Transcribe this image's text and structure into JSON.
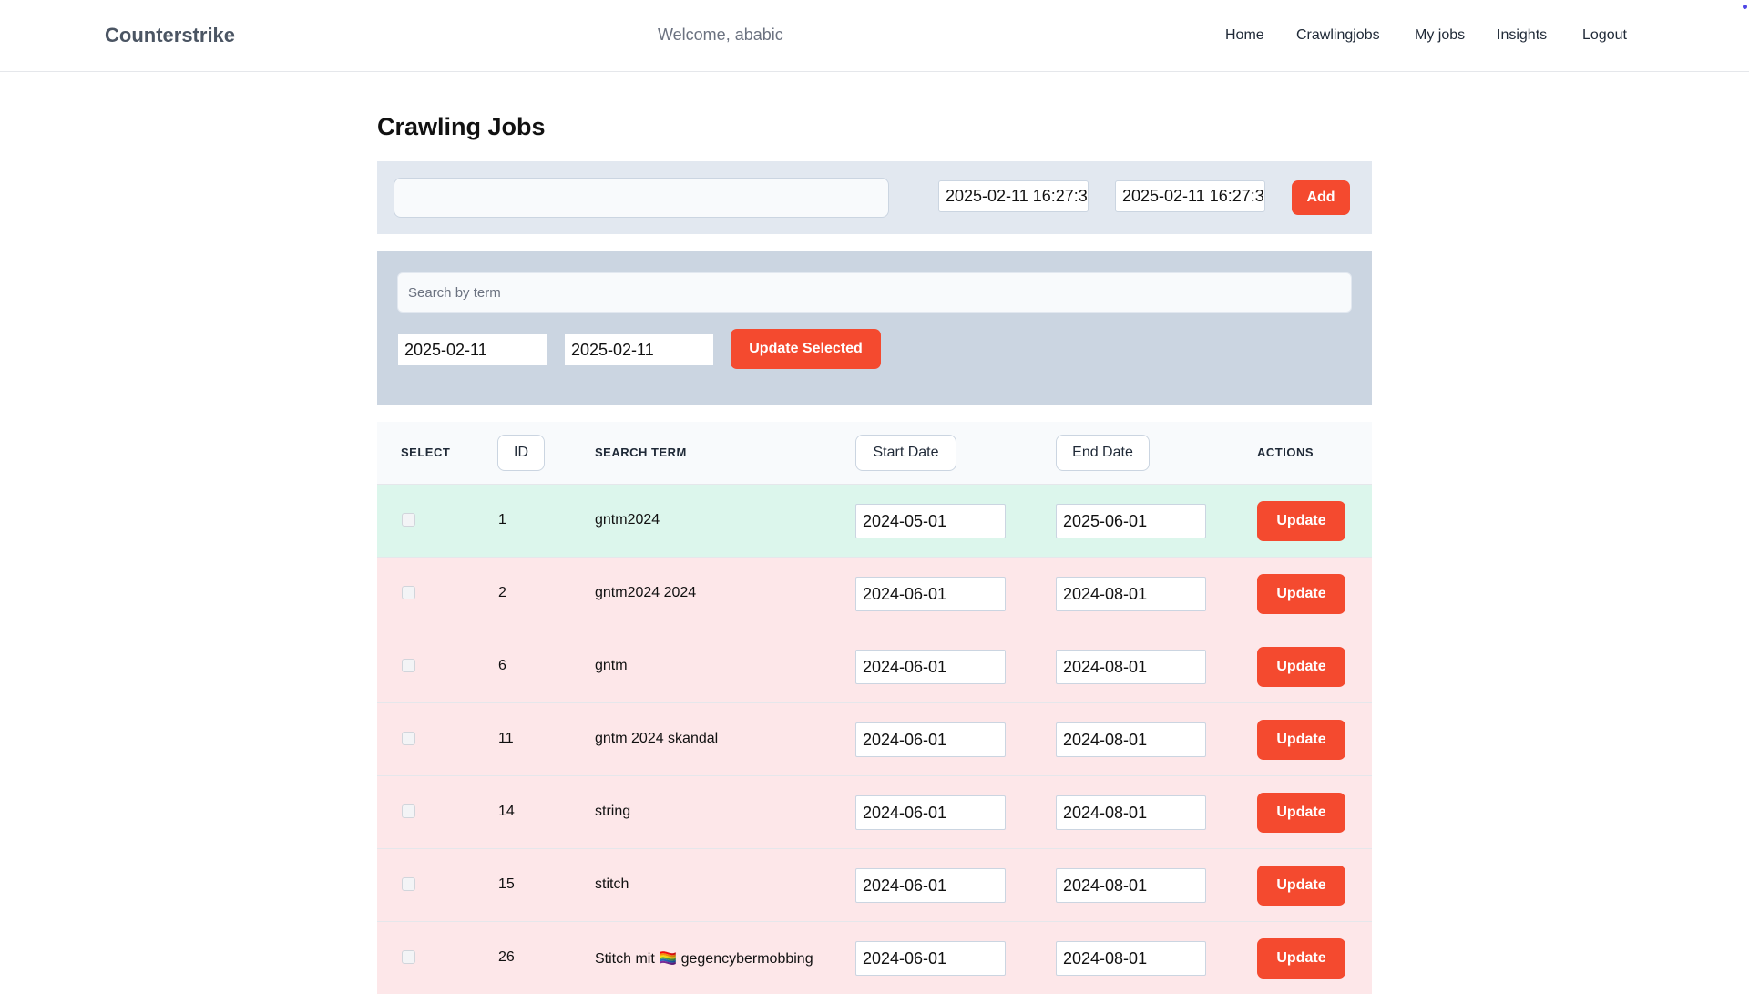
{
  "header": {
    "brand": "Counterstrike",
    "welcome": "Welcome, ababic",
    "nav": [
      "Home",
      "Crawlingjobs",
      "My jobs",
      "Insights",
      "Logout"
    ]
  },
  "page_title": "Crawling Jobs",
  "add_form": {
    "term_value": "",
    "start_datetime": "2025-02-11 16:27:3",
    "end_datetime": "2025-02-11 16:27:3",
    "add_label": "Add"
  },
  "filter": {
    "search_placeholder": "Search by term",
    "start_date": "2025-02-11",
    "end_date": "2025-02-11",
    "update_selected_label": "Update Selected"
  },
  "table": {
    "headers": {
      "select": "SELECT",
      "id": "ID",
      "term": "SEARCH TERM",
      "start": "Start Date",
      "end": "End Date",
      "actions": "ACTIONS"
    },
    "rows": [
      {
        "id": "1",
        "term": "gntm2024",
        "start": "2024-05-01",
        "end": "2025-06-01",
        "action": "Update"
      },
      {
        "id": "2",
        "term": "gntm2024 2024",
        "start": "2024-06-01",
        "end": "2024-08-01",
        "action": "Update"
      },
      {
        "id": "6",
        "term": "gntm",
        "start": "2024-06-01",
        "end": "2024-08-01",
        "action": "Update"
      },
      {
        "id": "11",
        "term": "gntm 2024 skandal",
        "start": "2024-06-01",
        "end": "2024-08-01",
        "action": "Update"
      },
      {
        "id": "14",
        "term": "string",
        "start": "2024-06-01",
        "end": "2024-08-01",
        "action": "Update"
      },
      {
        "id": "15",
        "term": "stitch",
        "start": "2024-06-01",
        "end": "2024-08-01",
        "action": "Update"
      },
      {
        "id": "26",
        "term": "Stitch mit 🏳️‍🌈 gegencybermobbing",
        "start": "2024-06-01",
        "end": "2024-08-01",
        "action": "Update"
      }
    ]
  },
  "colors": {
    "accent": "#f44a2f",
    "active_row": "#dcf6ec",
    "inactive_row": "#fde7e9"
  }
}
